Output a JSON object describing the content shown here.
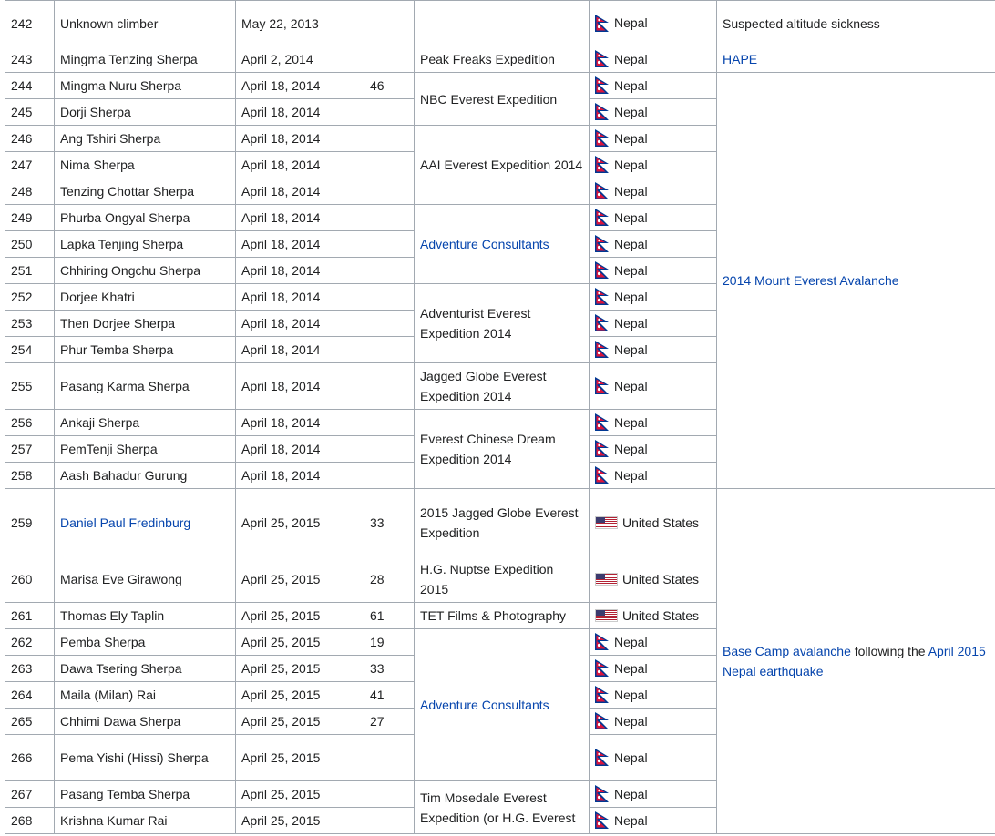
{
  "flags": {
    "Nepal": {
      "icon": "nepal-flag-icon",
      "crimson": "#dc143c",
      "blue": "#003893"
    },
    "United States": {
      "icon": "us-flag-icon",
      "red": "#b22234",
      "blue": "#3c3b6e"
    }
  },
  "rows": [
    {
      "num": "242",
      "name": "Unknown climber",
      "date": "May 22, 2013",
      "age": "",
      "nat": "Nepal"
    },
    {
      "num": "243",
      "name": "Mingma Tenzing Sherpa",
      "date": "April 2, 2014",
      "age": "",
      "nat": "Nepal"
    },
    {
      "num": "244",
      "name": "Mingma Nuru Sherpa",
      "date": "April 18, 2014",
      "age": "46",
      "nat": "Nepal"
    },
    {
      "num": "245",
      "name": "Dorji Sherpa",
      "date": "April 18, 2014",
      "age": "",
      "nat": "Nepal"
    },
    {
      "num": "246",
      "name": "Ang Tshiri Sherpa",
      "date": "April 18, 2014",
      "age": "",
      "nat": "Nepal"
    },
    {
      "num": "247",
      "name": "Nima Sherpa",
      "date": "April 18, 2014",
      "age": "",
      "nat": "Nepal"
    },
    {
      "num": "248",
      "name": "Tenzing Chottar Sherpa",
      "date": "April 18, 2014",
      "age": "",
      "nat": "Nepal"
    },
    {
      "num": "249",
      "name": "Phurba Ongyal Sherpa",
      "date": "April 18, 2014",
      "age": "",
      "nat": "Nepal"
    },
    {
      "num": "250",
      "name": "Lapka Tenjing Sherpa",
      "date": "April 18, 2014",
      "age": "",
      "nat": "Nepal"
    },
    {
      "num": "251",
      "name": "Chhiring Ongchu Sherpa",
      "date": "April 18, 2014",
      "age": "",
      "nat": "Nepal"
    },
    {
      "num": "252",
      "name": "Dorjee Khatri",
      "date": "April 18, 2014",
      "age": "",
      "nat": "Nepal"
    },
    {
      "num": "253",
      "name": "Then Dorjee Sherpa",
      "date": "April 18, 2014",
      "age": "",
      "nat": "Nepal"
    },
    {
      "num": "254",
      "name": "Phur Temba Sherpa",
      "date": "April 18, 2014",
      "age": "",
      "nat": "Nepal"
    },
    {
      "num": "255",
      "name": "Pasang Karma Sherpa",
      "date": "April 18, 2014",
      "age": "",
      "nat": "Nepal"
    },
    {
      "num": "256",
      "name": "Ankaji Sherpa",
      "date": "April 18, 2014",
      "age": "",
      "nat": "Nepal"
    },
    {
      "num": "257",
      "name": "PemTenji Sherpa",
      "date": "April 18, 2014",
      "age": "",
      "nat": "Nepal"
    },
    {
      "num": "258",
      "name": "Aash Bahadur Gurung",
      "date": "April 18, 2014",
      "age": "",
      "nat": "Nepal"
    },
    {
      "num": "259",
      "name": "Daniel Paul Fredinburg",
      "name_link": true,
      "date": "April 25, 2015",
      "age": "33",
      "nat": "United States"
    },
    {
      "num": "260",
      "name": "Marisa Eve Girawong",
      "date": "April 25, 2015",
      "age": "28",
      "nat": "United States"
    },
    {
      "num": "261",
      "name": "Thomas Ely Taplin",
      "date": "April 25, 2015",
      "age": "61",
      "nat": "United States"
    },
    {
      "num": "262",
      "name": "Pemba Sherpa",
      "date": "April 25, 2015",
      "age": "19",
      "nat": "Nepal"
    },
    {
      "num": "263",
      "name": "Dawa Tsering Sherpa",
      "date": "April 25, 2015",
      "age": "33",
      "nat": "Nepal"
    },
    {
      "num": "264",
      "name": "Maila (Milan) Rai",
      "date": "April 25, 2015",
      "age": "41",
      "nat": "Nepal"
    },
    {
      "num": "265",
      "name": "Chhimi Dawa Sherpa",
      "date": "April 25, 2015",
      "age": "27",
      "nat": "Nepal"
    },
    {
      "num": "266",
      "name": "Pema Yishi (Hissi) Sherpa",
      "date": "April 25, 2015",
      "age": "",
      "nat": "Nepal"
    },
    {
      "num": "267",
      "name": "Pasang Temba Sherpa",
      "date": "April 25, 2015",
      "age": "",
      "nat": "Nepal"
    },
    {
      "num": "268",
      "name": "Krishna Kumar Rai",
      "date": "April 25, 2015",
      "age": "",
      "nat": "Nepal"
    }
  ],
  "expeditions": [
    {
      "start": 0,
      "span": 1,
      "text": ""
    },
    {
      "start": 1,
      "span": 1,
      "text": "Peak Freaks Expedition"
    },
    {
      "start": 2,
      "span": 2,
      "text": "NBC Everest Expedition"
    },
    {
      "start": 4,
      "span": 3,
      "text": "AAI Everest Expedition 2014"
    },
    {
      "start": 7,
      "span": 3,
      "text": "Adventure Consultants",
      "link": true
    },
    {
      "start": 10,
      "span": 3,
      "text": "Adventurist Everest Expedition 2014"
    },
    {
      "start": 13,
      "span": 1,
      "text": "Jagged Globe Everest Expedition 2014"
    },
    {
      "start": 14,
      "span": 3,
      "text": "Everest Chinese Dream Expedition 2014"
    },
    {
      "start": 17,
      "span": 1,
      "text": "2015 Jagged Globe Everest Expedition"
    },
    {
      "start": 18,
      "span": 1,
      "text": "H.G. Nuptse Expedition 2015"
    },
    {
      "start": 19,
      "span": 1,
      "text": "TET Films & Photography"
    },
    {
      "start": 20,
      "span": 5,
      "text": "Adventure Consultants",
      "link": true
    },
    {
      "start": 25,
      "span": 2,
      "text": "Tim Mosedale Everest Expedition (or H.G. Everest"
    }
  ],
  "causes": [
    {
      "start": 0,
      "span": 1,
      "parts": [
        {
          "text": "Suspected altitude sickness"
        }
      ]
    },
    {
      "start": 1,
      "span": 1,
      "parts": [
        {
          "text": "HAPE",
          "link": true
        }
      ]
    },
    {
      "start": 2,
      "span": 15,
      "parts": [
        {
          "text": "2014 Mount Everest Avalanche",
          "link": true
        }
      ]
    },
    {
      "start": 17,
      "span": 10,
      "parts": [
        {
          "text": "Base Camp avalanche",
          "link": true
        },
        {
          "text": " following the "
        },
        {
          "text": "April 2015 Nepal earthquake",
          "link": true
        }
      ]
    }
  ]
}
